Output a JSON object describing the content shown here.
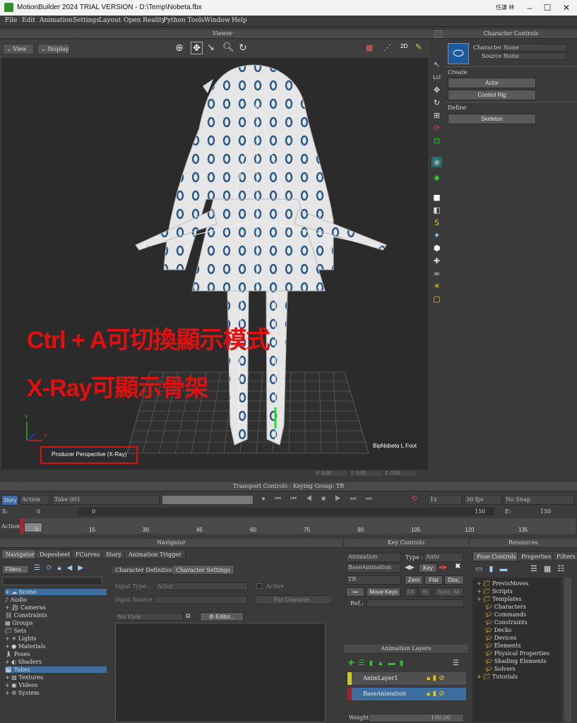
{
  "window": {
    "title": "MotionBuilder 2024 TRIAL VERSION - D:\\Temp\\Nobeta.fbx",
    "user": "任謙 林",
    "minimize": "–",
    "maximize": "☐",
    "close": "✕"
  },
  "menu": [
    "File",
    "Edit",
    "Animation",
    "Settings",
    "Layout",
    "Open Reality",
    "Python Tools",
    "Window",
    "Help"
  ],
  "viewer": {
    "header": "Viewer",
    "view_btn": "View",
    "display_btn": "Display",
    "camera_label": "Producer Perspective (X-Ray)",
    "hover_label": "BipNobeta L Foot",
    "axis_x": "X",
    "axis_y": "Y",
    "annotation_line1": "Ctrl + A可切換顯示模式",
    "annotation_line2": "X-Ray可顯示骨架",
    "annotation_color": "#e01010",
    "coord_values": [
      "0.00",
      "0.00",
      "0.00"
    ],
    "coord_labels": [
      "X",
      "Y",
      "Z"
    ]
  },
  "character_controls": {
    "header": "Character Controls",
    "character_label": "Character:",
    "character_value": "None",
    "source_label": "Source:",
    "source_value": "None",
    "create_label": "Create",
    "actor_btn": "Actor",
    "control_rig_btn": "Control Rig",
    "define_label": "Define",
    "skeleton_btn": "Skeleton"
  },
  "transport": {
    "header": "Transport Controls  -  Keying Group: TR",
    "story_btn": "Story",
    "action_dd": "Action",
    "take_dd": "Take 001",
    "speed": "1x",
    "fps": "30 fps",
    "snap": "No Snap",
    "start_label": "S:",
    "start_value": "0",
    "current_value": "0",
    "end_value": "150",
    "end_label": "E:",
    "end_value2": "150",
    "action_label": "Action",
    "ticks": [
      "0",
      "15",
      "30",
      "45",
      "60",
      "75",
      "90",
      "105",
      "120",
      "135"
    ]
  },
  "navigator": {
    "header": "Navigator",
    "tabs": [
      "Navigator",
      "Dopesheet",
      "FCurves",
      "Story",
      "Animation Trigger"
    ],
    "filters_btn": "Filters...",
    "tree": [
      "Scene",
      "Audio",
      "Cameras",
      "Constraints",
      "Groups",
      "Sets",
      "Lights",
      "Materials",
      "Poses",
      "Shaders",
      "Takes",
      "Textures",
      "Videos",
      "System"
    ],
    "sub_tabs": [
      "Character Definition",
      "Character Settings"
    ],
    "input_type_label": "Input Type :",
    "input_type_value": "Actor",
    "active_label": "Active",
    "input_source_label": "Input Source :",
    "plot_btn": "Plot Character...",
    "no_view": "No View",
    "editor_btn": "Editor..."
  },
  "key_controls": {
    "header": "Key Controls",
    "animation_dd": "Animation",
    "type_label": "Type :",
    "type_value": "Auto",
    "base_dd": "BaseAnimation",
    "key_btn": "Key",
    "tr_dd": "TR",
    "zero_btn": "Zero",
    "flat_btn": "Flat",
    "disc_btn": "Disc.",
    "move_keys_btn": "Move Keys",
    "fk_btn": "FK",
    "ik_btn": "IK",
    "sync_btn": "Sync. All",
    "ref_label": "Ref.:",
    "layers_header": "Animation Layers",
    "layers": [
      {
        "name": "AnimLayer1",
        "color": "#c8c830"
      },
      {
        "name": "BaseAnimation",
        "color": "#a02030"
      }
    ],
    "weight_label": "Weight",
    "weight_value": "100.00"
  },
  "resources": {
    "header": "Resources",
    "tabs": [
      "Pose Controls",
      "Properties",
      "Filters"
    ],
    "tree": [
      {
        "label": "PrevisMoves",
        "level": 0
      },
      {
        "label": "Scripts",
        "level": 0
      },
      {
        "label": "Templates",
        "level": 0
      },
      {
        "label": "Characters",
        "level": 1
      },
      {
        "label": "Commands",
        "level": 1
      },
      {
        "label": "Constraints",
        "level": 1
      },
      {
        "label": "Decks",
        "level": 1
      },
      {
        "label": "Devices",
        "level": 1
      },
      {
        "label": "Elements",
        "level": 1
      },
      {
        "label": "Physical Properties",
        "level": 1
      },
      {
        "label": "Shading Elements",
        "level": 1
      },
      {
        "label": "Solvers",
        "level": 1
      },
      {
        "label": "Tutorials",
        "level": 0
      }
    ]
  }
}
